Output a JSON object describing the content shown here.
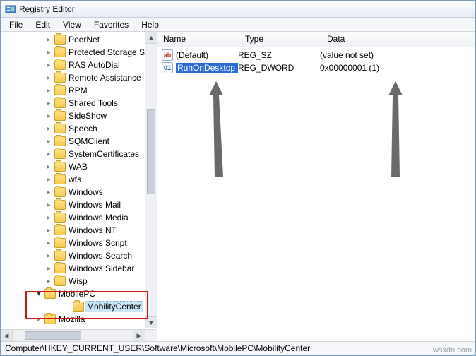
{
  "window": {
    "title": "Registry Editor"
  },
  "menu": {
    "file": "File",
    "edit": "Edit",
    "view": "View",
    "favorites": "Favorites",
    "help": "Help"
  },
  "tree": {
    "items": [
      "PeerNet",
      "Protected Storage S",
      "RAS AutoDial",
      "Remote Assistance",
      "RPM",
      "Shared Tools",
      "SideShow",
      "Speech",
      "SQMClient",
      "SystemCertificates",
      "WAB",
      "wfs",
      "Windows",
      "Windows Mail",
      "Windows Media",
      "Windows NT",
      "Windows Script",
      "Windows Search",
      "Windows Sidebar",
      "Wisp"
    ],
    "mobile": {
      "parent": "MobilePC",
      "child": "MobilityCenter"
    },
    "last": "Mozilla"
  },
  "columns": {
    "name": "Name",
    "type": "Type",
    "data": "Data"
  },
  "values": [
    {
      "icon": "sz",
      "name": "(Default)",
      "type": "REG_SZ",
      "data": "(value not set)",
      "sel": false
    },
    {
      "icon": "dw",
      "name": "RunOnDesktop",
      "type": "REG_DWORD",
      "data": "0x00000001 (1)",
      "sel": true
    }
  ],
  "status": "Computer\\HKEY_CURRENT_USER\\Software\\Microsoft\\MobilePC\\MobilityCenter",
  "watermark": "wsxdn.com",
  "icon_text": {
    "sz": "ab",
    "dw": "011\n110"
  }
}
